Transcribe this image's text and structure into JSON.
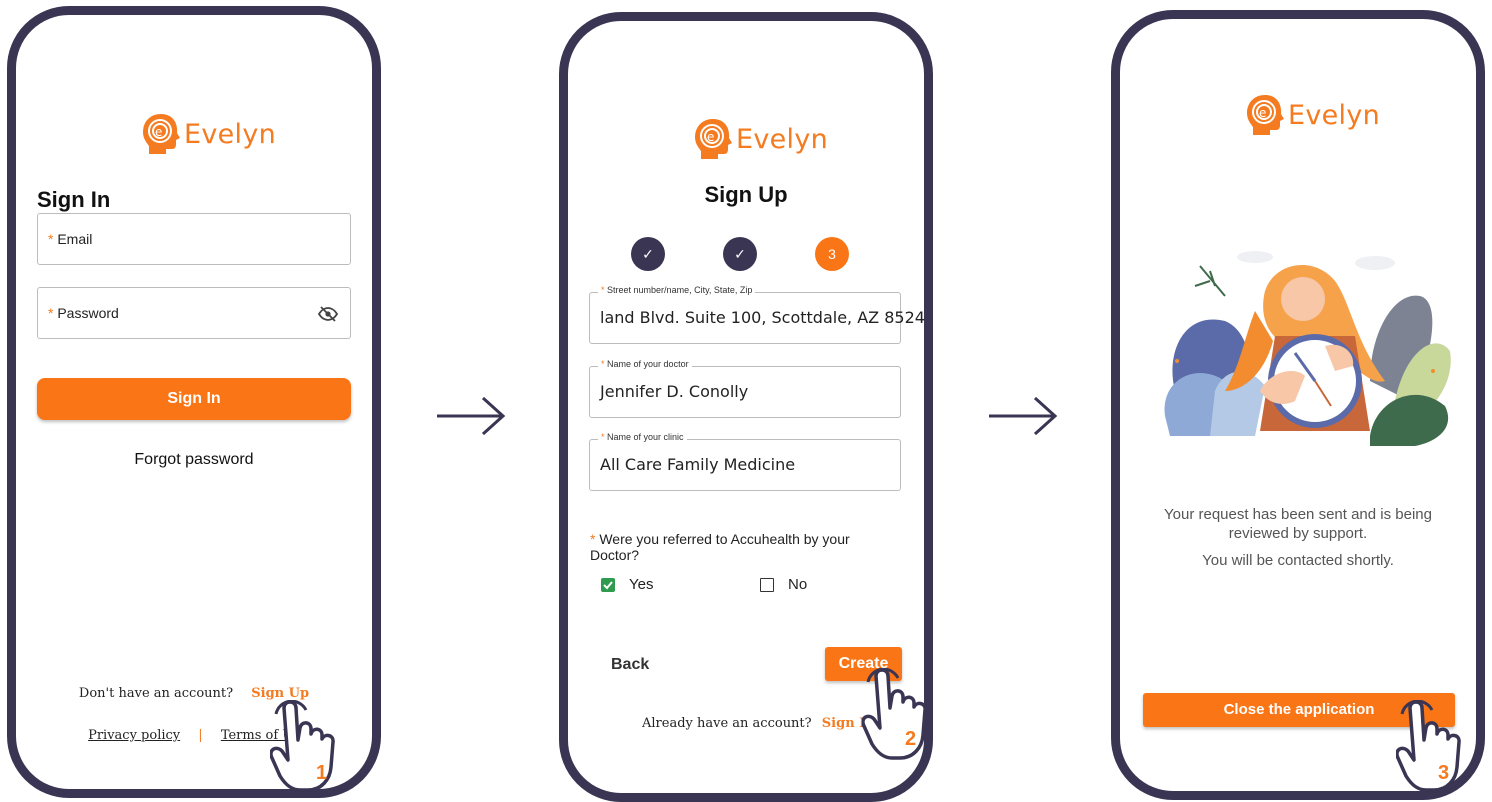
{
  "brand": {
    "name": "Evelyn",
    "color": "#f47b20",
    "frame_color": "#3a3553"
  },
  "screen1": {
    "title": "Sign In",
    "email_label": "Email",
    "password_label": "Password",
    "required_mark": "*",
    "eye_icon": "eye-off-icon",
    "signin_button": "Sign In",
    "forgot_link": "Forgot password",
    "no_account_text": "Don't have an account?",
    "signup_link": "Sign Up",
    "privacy_link": "Privacy policy",
    "separator": "|",
    "terms_link": "Terms of Us",
    "step_number": "1"
  },
  "screen2": {
    "title": "Sign Up",
    "steps": [
      {
        "state": "done",
        "label": "✓"
      },
      {
        "state": "done",
        "label": "✓"
      },
      {
        "state": "current",
        "label": "3"
      }
    ],
    "address_label": "Street number/name, City, State, Zip",
    "address_value": "land Blvd. Suite 100, Scottdale, AZ 8524",
    "doctor_label": "Name of your doctor",
    "doctor_value": "Jennifer D. Conolly",
    "clinic_label": "Name of your clinic",
    "clinic_value": "All Care Family Medicine",
    "question": "Were you referred to Accuhealth by your Doctor?",
    "required_mark": "*",
    "option_yes": "Yes",
    "option_no": "No",
    "yes_checked": true,
    "no_checked": false,
    "back_button": "Back",
    "create_button": "Create",
    "have_account_text": "Already have an account?",
    "signin_link": "Sign In",
    "step_number": "2"
  },
  "screen3": {
    "message_line1": "Your request has been sent and is being reviewed by support.",
    "message_line2": "You will be contacted shortly.",
    "close_button": "Close the application",
    "step_number": "3"
  }
}
